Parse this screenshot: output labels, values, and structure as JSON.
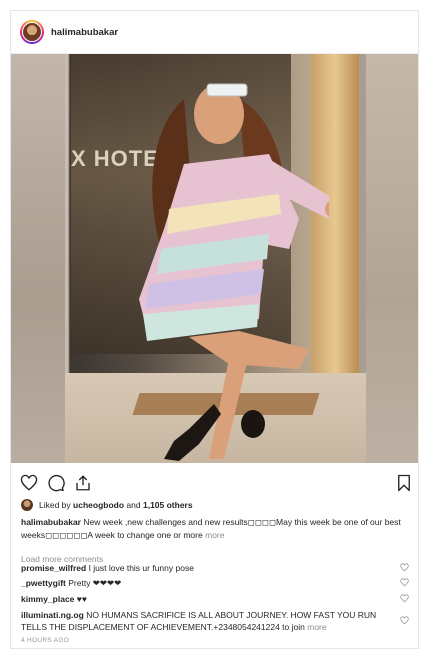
{
  "post": {
    "username": "halimabubakar",
    "photo_sign_text": "X HOTEL"
  },
  "icons": {
    "like": "heart-icon",
    "comment": "comment-icon",
    "share": "share-icon",
    "save": "bookmark-icon"
  },
  "likes": {
    "prefix": "Liked by",
    "liker": "ucheogbodo",
    "and": "and",
    "count_text": "1,105 others"
  },
  "caption": {
    "username": "halimabubakar",
    "text": "New week ,new challenges and new results◻◻◻◻May this week be one of our best weeks◻◻◻◻◻◻A week to change one or more",
    "more_label": "more"
  },
  "load_more_label": "Load more comments",
  "comments": [
    {
      "username": "promise_wilfred",
      "text": "I just love this ur funny pose"
    },
    {
      "username": "_pwettygift",
      "text": "Pretty ❤❤❤❤"
    },
    {
      "username": "kimmy_place",
      "text": "♥♥"
    },
    {
      "username": "illuminati.ng.og",
      "text": "NO HUMANS SACRIFICE IS ALL ABOUT JOURNEY. HOW FAST YOU RUN TELLS THE DISPLACEMENT OF ACHIEVEMENT.+2348054241224 to join",
      "more_label": "more"
    }
  ],
  "timestamp": "4 HOURS AGO",
  "colors": {
    "text": "#262626",
    "muted": "#8e8e8e",
    "border": "#e6e6e6"
  }
}
